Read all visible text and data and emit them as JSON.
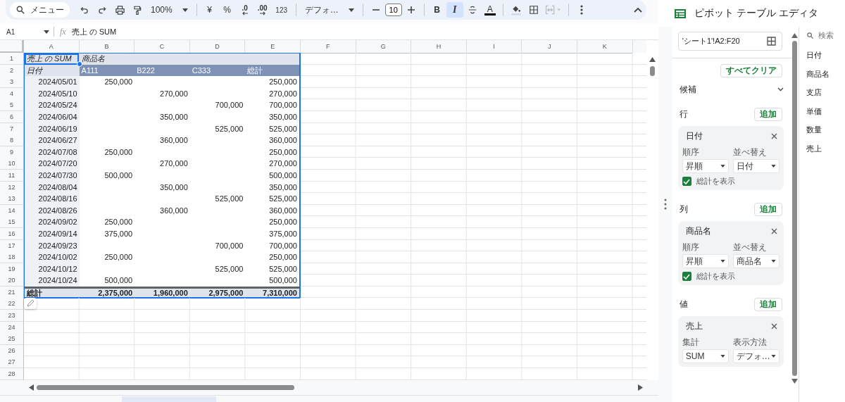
{
  "toolbar": {
    "search_menu": "メニュー",
    "zoom": "100%",
    "currency": "¥",
    "percent": "%",
    "decimal_decrease": ".0",
    "decimal_increase": ".00",
    "number_format": "123",
    "font": "デフォ…",
    "font_size": "10",
    "bold": {
      "label": "B",
      "selected": false
    },
    "italic": {
      "label": "I",
      "selected": true
    },
    "text_color": "A",
    "merge": {
      "disabled": true
    }
  },
  "formula_bar": {
    "cell": "A1",
    "fx": "fx",
    "formula": "売上 の SUM"
  },
  "sheet": {
    "columns": [
      "A",
      "B",
      "C",
      "D",
      "E",
      "F",
      "G",
      "H",
      "I",
      "J",
      "K"
    ],
    "rows": [
      {
        "number": "1",
        "kind": "field-header",
        "cells": [
          "売上 の SUM",
          "商品名",
          null,
          null,
          null
        ]
      },
      {
        "number": "2",
        "kind": "column-header",
        "cells": [
          "日付",
          "A111",
          "B222",
          "C333",
          "総計"
        ]
      },
      {
        "number": "3",
        "kind": "data",
        "cells": [
          "2024/05/01",
          "250,000",
          null,
          null,
          "250,000"
        ]
      },
      {
        "number": "4",
        "kind": "data",
        "cells": [
          "2024/05/10",
          null,
          "270,000",
          null,
          "270,000"
        ]
      },
      {
        "number": "5",
        "kind": "data",
        "cells": [
          "2024/05/24",
          null,
          null,
          "700,000",
          "700,000"
        ]
      },
      {
        "number": "6",
        "kind": "data",
        "cells": [
          "2024/06/04",
          null,
          "350,000",
          null,
          "350,000"
        ]
      },
      {
        "number": "7",
        "kind": "data",
        "cells": [
          "2024/06/19",
          null,
          null,
          "525,000",
          "525,000"
        ]
      },
      {
        "number": "8",
        "kind": "data",
        "cells": [
          "2024/06/27",
          null,
          "360,000",
          null,
          "360,000"
        ]
      },
      {
        "number": "9",
        "kind": "data",
        "cells": [
          "2024/07/08",
          "250,000",
          null,
          null,
          "250,000"
        ]
      },
      {
        "number": "10",
        "kind": "data",
        "cells": [
          "2024/07/20",
          null,
          "270,000",
          null,
          "270,000"
        ]
      },
      {
        "number": "11",
        "kind": "data",
        "cells": [
          "2024/07/30",
          "500,000",
          null,
          null,
          "500,000"
        ]
      },
      {
        "number": "12",
        "kind": "data",
        "cells": [
          "2024/08/04",
          null,
          "350,000",
          null,
          "350,000"
        ]
      },
      {
        "number": "13",
        "kind": "data",
        "cells": [
          "2024/08/16",
          null,
          null,
          "525,000",
          "525,000"
        ]
      },
      {
        "number": "14",
        "kind": "data",
        "cells": [
          "2024/08/26",
          null,
          "360,000",
          null,
          "360,000"
        ]
      },
      {
        "number": "15",
        "kind": "data",
        "cells": [
          "2024/09/02",
          "250,000",
          null,
          null,
          "250,000"
        ]
      },
      {
        "number": "16",
        "kind": "data",
        "cells": [
          "2024/09/14",
          "375,000",
          null,
          null,
          "375,000"
        ]
      },
      {
        "number": "17",
        "kind": "data",
        "cells": [
          "2024/09/23",
          null,
          null,
          "700,000",
          "700,000"
        ]
      },
      {
        "number": "18",
        "kind": "data",
        "cells": [
          "2024/10/02",
          "250,000",
          null,
          null,
          "250,000"
        ]
      },
      {
        "number": "19",
        "kind": "data",
        "cells": [
          "2024/10/12",
          null,
          null,
          "525,000",
          "525,000"
        ]
      },
      {
        "number": "20",
        "kind": "data",
        "cells": [
          "2024/10/24",
          "500,000",
          null,
          null,
          "500,000"
        ]
      },
      {
        "number": "21",
        "kind": "total",
        "cells": [
          "総計",
          "2,375,000",
          "1,960,000",
          "2,975,000",
          "7,310,000"
        ]
      },
      {
        "number": "22",
        "kind": "empty"
      },
      {
        "number": "23",
        "kind": "empty"
      },
      {
        "number": "24",
        "kind": "empty"
      },
      {
        "number": "25",
        "kind": "empty"
      },
      {
        "number": "26",
        "kind": "empty"
      },
      {
        "number": "27",
        "kind": "empty"
      },
      {
        "number": "28",
        "kind": "empty"
      }
    ]
  },
  "sidebar": {
    "title": "ピボット テーブル エディタ",
    "range": "'シート1'!A2:F20",
    "clear": "すべてクリア",
    "suggestions": "候補",
    "sections": [
      {
        "label": "行",
        "add": "追加",
        "card": {
          "field": "日付",
          "left_label": "順序",
          "left_value": "昇順",
          "right_label": "並べ替え",
          "right_value": "日付",
          "totals": {
            "label": "総計を表示",
            "checked": true
          }
        }
      },
      {
        "label": "列",
        "add": "追加",
        "card": {
          "field": "商品名",
          "left_label": "順序",
          "left_value": "昇順",
          "right_label": "並べ替え",
          "right_value": "商品名",
          "totals": {
            "label": "総計を表示",
            "checked": true
          }
        }
      },
      {
        "label": "値",
        "add": "追加",
        "card": {
          "field": "売上",
          "left_label": "集計",
          "left_value": "SUM",
          "right_label": "表示方法",
          "right_value": "デフォ…"
        }
      }
    ]
  },
  "field_list": {
    "search_placeholder": "検索",
    "fields": [
      "日付",
      "商品名",
      "支店",
      "単価",
      "数量",
      "売上"
    ]
  }
}
